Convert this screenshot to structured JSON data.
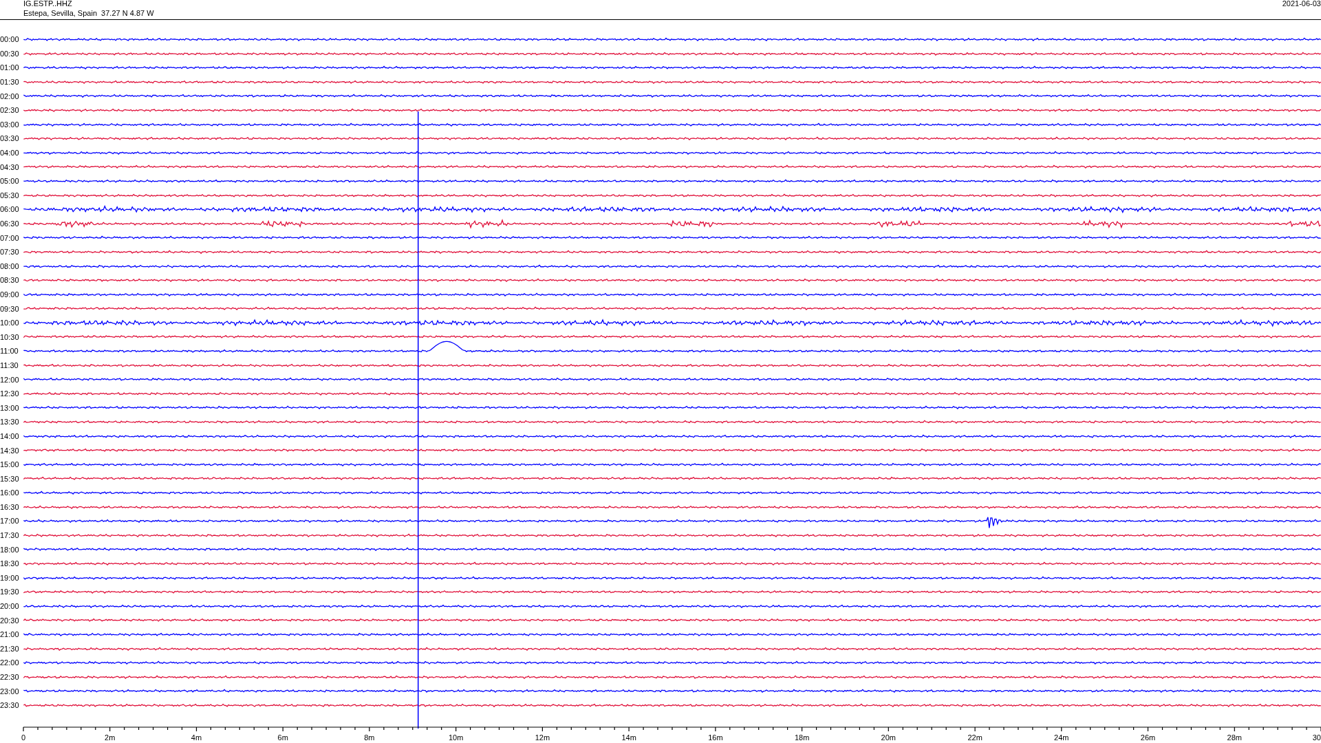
{
  "header": {
    "station": "IG.ESTP..HHZ",
    "location": "Estepa, Sevilla, Spain  37.27 N 4.87 W",
    "date": "2021-06-03"
  },
  "traces": [
    {
      "label": "00:00",
      "color": "#0000ff"
    },
    {
      "label": "00:30",
      "color": "#e0103a"
    },
    {
      "label": "01:00",
      "color": "#0000ff"
    },
    {
      "label": "01:30",
      "color": "#e0103a"
    },
    {
      "label": "02:00",
      "color": "#0000ff"
    },
    {
      "label": "02:30",
      "color": "#e0103a"
    },
    {
      "label": "03:00",
      "color": "#0000ff"
    },
    {
      "label": "03:30",
      "color": "#e0103a"
    },
    {
      "label": "04:00",
      "color": "#0000ff"
    },
    {
      "label": "04:30",
      "color": "#e0103a"
    },
    {
      "label": "05:00",
      "color": "#0000ff"
    },
    {
      "label": "05:30",
      "color": "#e0103a"
    },
    {
      "label": "06:00",
      "color": "#0000ff"
    },
    {
      "label": "06:30",
      "color": "#e0103a"
    },
    {
      "label": "07:00",
      "color": "#0000ff"
    },
    {
      "label": "07:30",
      "color": "#e0103a"
    },
    {
      "label": "08:00",
      "color": "#0000ff"
    },
    {
      "label": "08:30",
      "color": "#e0103a"
    },
    {
      "label": "09:00",
      "color": "#0000ff"
    },
    {
      "label": "09:30",
      "color": "#e0103a"
    },
    {
      "label": "10:00",
      "color": "#0000ff"
    },
    {
      "label": "10:30",
      "color": "#e0103a"
    },
    {
      "label": "11:00",
      "color": "#0000ff"
    },
    {
      "label": "11:30",
      "color": "#e0103a"
    },
    {
      "label": "12:00",
      "color": "#0000ff"
    },
    {
      "label": "12:30",
      "color": "#e0103a"
    },
    {
      "label": "13:00",
      "color": "#0000ff"
    },
    {
      "label": "13:30",
      "color": "#e0103a"
    },
    {
      "label": "14:00",
      "color": "#0000ff"
    },
    {
      "label": "14:30",
      "color": "#e0103a"
    },
    {
      "label": "15:00",
      "color": "#0000ff"
    },
    {
      "label": "15:30",
      "color": "#e0103a"
    },
    {
      "label": "16:00",
      "color": "#0000ff"
    },
    {
      "label": "16:30",
      "color": "#e0103a"
    },
    {
      "label": "17:00",
      "color": "#0000ff"
    },
    {
      "label": "17:30",
      "color": "#e0103a"
    },
    {
      "label": "18:00",
      "color": "#0000ff"
    },
    {
      "label": "18:30",
      "color": "#e0103a"
    },
    {
      "label": "19:00",
      "color": "#0000ff"
    },
    {
      "label": "19:30",
      "color": "#e0103a"
    },
    {
      "label": "20:00",
      "color": "#0000ff"
    },
    {
      "label": "20:30",
      "color": "#e0103a"
    },
    {
      "label": "21:00",
      "color": "#0000ff"
    },
    {
      "label": "21:30",
      "color": "#e0103a"
    },
    {
      "label": "22:00",
      "color": "#0000ff"
    },
    {
      "label": "22:30",
      "color": "#e0103a"
    },
    {
      "label": "23:00",
      "color": "#0000ff"
    },
    {
      "label": "23:30",
      "color": "#e0103a"
    }
  ],
  "x_axis": {
    "ticks": [
      "0",
      "2m",
      "4m",
      "6m",
      "8m",
      "10m",
      "12m",
      "14m",
      "16m",
      "18m",
      "20m",
      "22m",
      "24m",
      "26m",
      "28m",
      "30"
    ]
  }
}
